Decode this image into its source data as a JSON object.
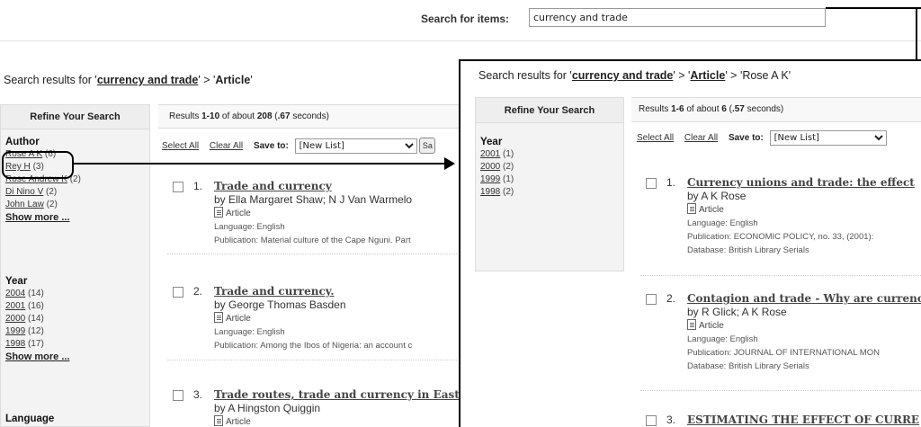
{
  "search": {
    "label": "Search for items:",
    "value": "currency and trade"
  },
  "background_page": {
    "header": {
      "prefix": "Search results for '",
      "query": "currency and trade",
      "middle": "' > '",
      "facet": "Article",
      "suffix": "'"
    },
    "refine_title": "Refine Your Search",
    "results_summary": {
      "prefix": "Results ",
      "range": "1-10",
      "middle": " of about ",
      "total": "208",
      "timing_prefix": " (",
      "timing": ".67",
      "timing_suffix": " seconds)"
    },
    "toolbar": {
      "select_all": "Select All",
      "clear_all": "Clear All",
      "save_to_label": "Save to:",
      "list_value": "[New List]",
      "save_button": "Sa"
    },
    "author_facet": {
      "heading": "Author",
      "items": [
        {
          "name": "Rose A K",
          "count": "(6)"
        },
        {
          "name": "Rey H",
          "count": "(3)"
        },
        {
          "name": "Rose Andrew K",
          "count": "(2)"
        },
        {
          "name": "Di Nino V",
          "count": "(2)"
        },
        {
          "name": "John Law",
          "count": "(2)"
        }
      ],
      "more": "Show more ..."
    },
    "year_facet": {
      "heading": "Year",
      "items": [
        {
          "name": "2004",
          "count": "(14)"
        },
        {
          "name": "2001",
          "count": "(16)"
        },
        {
          "name": "2000",
          "count": "(14)"
        },
        {
          "name": "1999",
          "count": "(12)"
        },
        {
          "name": "1998",
          "count": "(17)"
        }
      ],
      "more": "Show more ..."
    },
    "language_facet": {
      "heading": "Language"
    },
    "results": [
      {
        "num": "1.",
        "title": "Trade and currency",
        "by": "by Ella Margaret Shaw; N J Van Warmelo",
        "type": "Article",
        "language": "Language: English",
        "publication": "Publication: Material culture of the Cape Nguni. Part"
      },
      {
        "num": "2.",
        "title": "Trade and currency.",
        "by": "by George Thomas Basden",
        "type": "Article",
        "language": "Language: English",
        "publication": "Publication: Among the Ibos of Nigeria: an account c"
      },
      {
        "num": "3.",
        "title": "Trade routes, trade and currency in East",
        "by": "by A Hingston Quiggin",
        "type": "Article"
      }
    ]
  },
  "foreground_page": {
    "header": {
      "prefix": "Search results for '",
      "query": "currency and trade",
      "middle": "' > '",
      "facet": "Article",
      "middle2": "' > 'Rose A K'"
    },
    "refine_title": "Refine Your Search",
    "results_summary": {
      "prefix": "Results ",
      "range": "1-6",
      "middle": " of about ",
      "total": "6",
      "timing_prefix": " (",
      "timing": ".57",
      "timing_suffix": " seconds)"
    },
    "toolbar": {
      "select_all": "Select All",
      "clear_all": "Clear All",
      "save_to_label": "Save to:",
      "list_value": "[New List]"
    },
    "year_facet": {
      "heading": "Year",
      "items": [
        {
          "name": "2001",
          "count": "(1)"
        },
        {
          "name": "2000",
          "count": "(2)"
        },
        {
          "name": "1999",
          "count": "(1)"
        },
        {
          "name": "1998",
          "count": "(2)"
        }
      ]
    },
    "results": [
      {
        "num": "1.",
        "title": "Currency unions and trade: the effect",
        "by": "by A K Rose",
        "type": "Article",
        "language": "Language: English",
        "publication": "Publication: ECONOMIC POLICY, no. 33, (2001):",
        "database": "Database: British Library Serials"
      },
      {
        "num": "2.",
        "title": "Contagion and trade - Why are currenc",
        "by": "by R Glick; A K Rose",
        "type": "Article",
        "language": "Language: English",
        "publication": "Publication: JOURNAL OF INTERNATIONAL MON",
        "database": "Database: British Library Serials"
      },
      {
        "num": "3.",
        "title": "ESTIMATING THE EFFECT OF CURRE"
      }
    ]
  }
}
